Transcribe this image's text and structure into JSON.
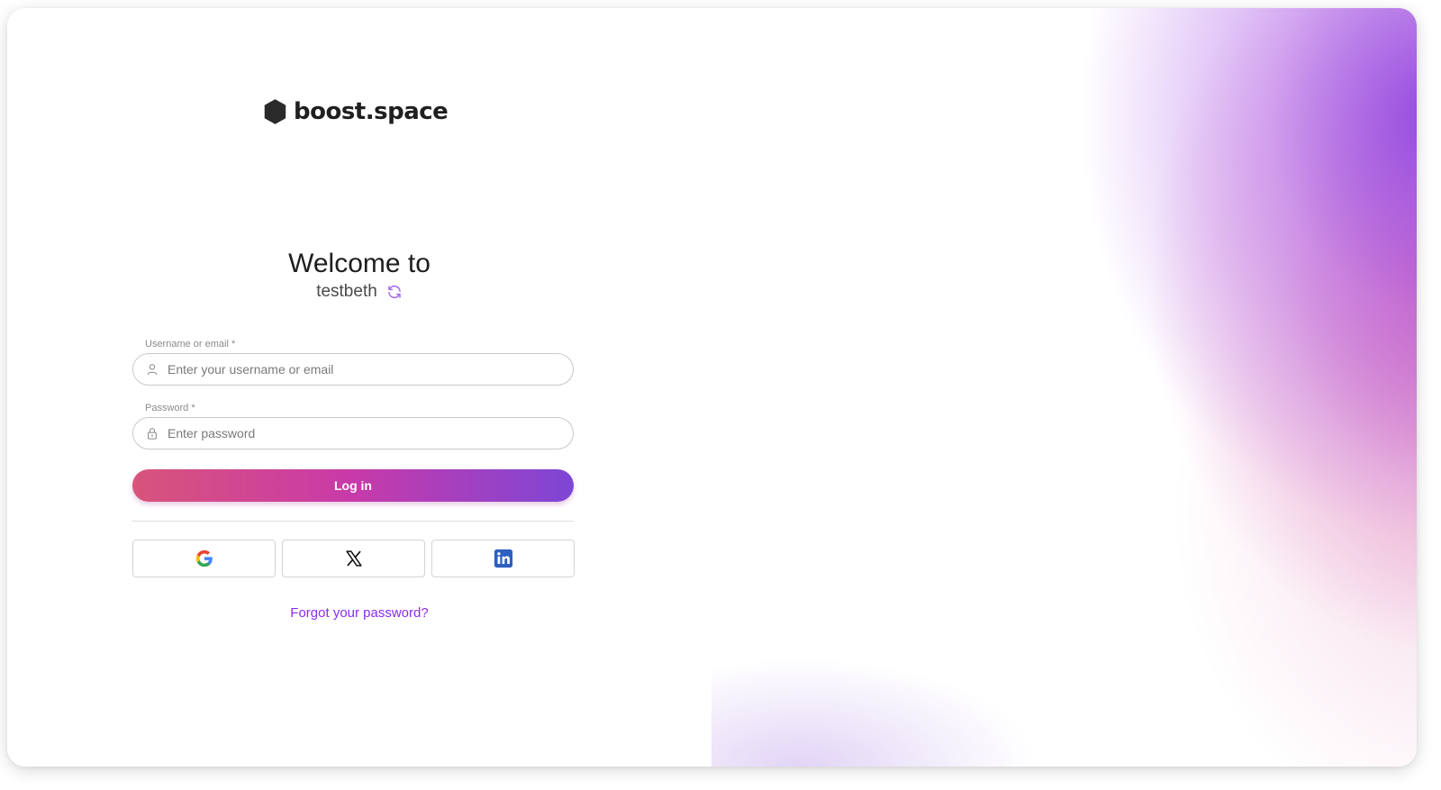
{
  "brand": {
    "name": "boost.space",
    "icon": "hexagon-logo-icon"
  },
  "welcome": {
    "heading": "Welcome to",
    "workspace": "testbeth",
    "switch_icon": "refresh-icon"
  },
  "form": {
    "username": {
      "label": "Username or email *",
      "placeholder": "Enter your username or email",
      "value": "",
      "icon": "user-icon"
    },
    "password": {
      "label": "Password *",
      "placeholder": "Enter password",
      "value": "",
      "icon": "lock-icon"
    },
    "submit_label": "Log in"
  },
  "social": [
    {
      "provider": "google",
      "icon": "google-icon"
    },
    {
      "provider": "x",
      "icon": "x-icon"
    },
    {
      "provider": "linkedin",
      "icon": "linkedin-icon"
    }
  ],
  "forgot_link": "Forgot your password?",
  "colors": {
    "accent": "#8b2cf0",
    "button_gradient": [
      "#d8547a",
      "#c83aa9",
      "#7d46d6"
    ],
    "refresh_icon": "#a46cf2"
  }
}
